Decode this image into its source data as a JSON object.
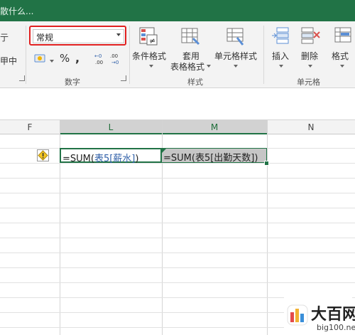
{
  "title_bar": {
    "tell_me": "散什么..."
  },
  "ribbon": {
    "left_cut_top": "亍",
    "left_cut_mid": "甲中",
    "number_format": {
      "value": "常规"
    },
    "number_group": {
      "currency_symbol": "$",
      "percent_symbol": "%",
      "comma_symbol": ",",
      "inc_decimal": "←0 .00",
      "dec_decimal": ".00 →0",
      "label": "数字"
    },
    "styles_group": {
      "conditional_format": "条件格式",
      "table_format_l1": "套用",
      "table_format_l2": "表格格式",
      "cell_styles": "单元格样式",
      "label": "样式"
    },
    "cells_group": {
      "insert": "插入",
      "delete": "删除",
      "format": "格式",
      "label": "单元格"
    }
  },
  "grid": {
    "columns": [
      "F",
      "L",
      "M",
      "N"
    ],
    "cell_L": {
      "prefix": "=SUM(",
      "ref": "表5[薪水]",
      "suffix": ")"
    },
    "cell_M": {
      "prefix": "=SUM(",
      "ref": "表5[出勤天数]",
      "suffix": ")"
    }
  },
  "watermark": {
    "name": "大百网",
    "url": "big100.net"
  },
  "colors": {
    "accent": "#217346",
    "highlight": "#e02020",
    "formula_ref": "#2f5fa8"
  }
}
